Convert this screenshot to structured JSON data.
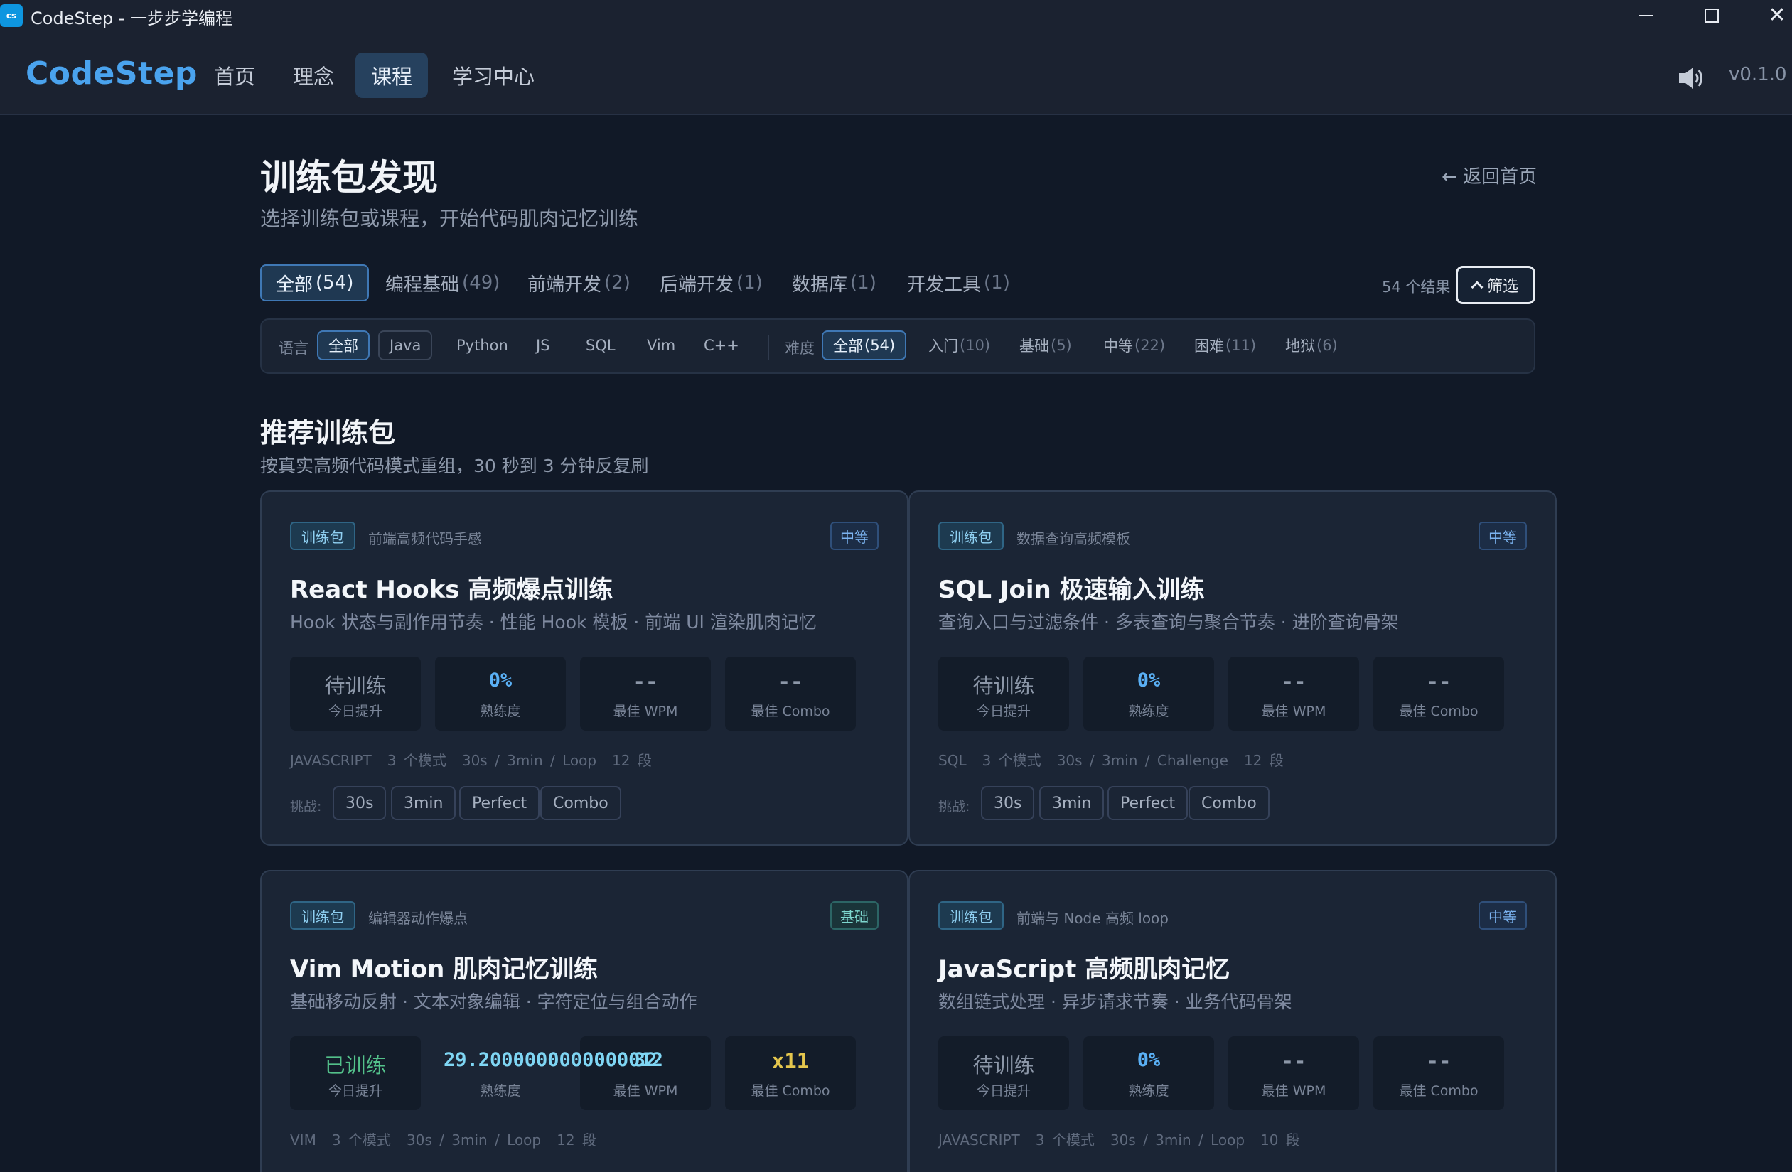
{
  "window": {
    "icon_text": "cs",
    "title": "CodeStep - 一步步学编程",
    "controls": {
      "minimize": "minimize",
      "maximize": "maximize",
      "close": "✕"
    }
  },
  "nav": {
    "brand": "CodeStep",
    "items": [
      "首页",
      "理念",
      "课程",
      "学习中心"
    ],
    "active_index": 2,
    "version": "v0.1.0"
  },
  "header": {
    "title": "训练包发现",
    "subtitle": "选择训练包或课程，开始代码肌肉记忆训练",
    "back_link": "← 返回首页"
  },
  "categories": [
    {
      "label": "全部",
      "count": "(54)",
      "active": true
    },
    {
      "label": "编程基础",
      "count": "(49)"
    },
    {
      "label": "前端开发",
      "count": "(2)"
    },
    {
      "label": "后端开发",
      "count": "(1)"
    },
    {
      "label": "数据库",
      "count": "(1)"
    },
    {
      "label": "开发工具",
      "count": "(1)"
    }
  ],
  "result_count": "54 个结果",
  "filter_button": "筛选",
  "filters": {
    "language_label": "语言",
    "languages": [
      "全部",
      "Java",
      "Python",
      "JS",
      "SQL",
      "Vim",
      "C++"
    ],
    "difficulty_label": "难度",
    "difficulties": [
      {
        "label": "全部",
        "count": "(54)"
      },
      {
        "label": "入门",
        "count": "(10)"
      },
      {
        "label": "基础",
        "count": "(5)"
      },
      {
        "label": "中等",
        "count": "(22)"
      },
      {
        "label": "困难",
        "count": "(11)"
      },
      {
        "label": "地狱",
        "count": "(6)"
      }
    ]
  },
  "section": {
    "title": "推荐训练包",
    "subtitle": "按真实高频代码模式重组，30 秒到 3 分钟反复刷"
  },
  "cards": [
    {
      "tag": "训练包",
      "desc": "前端高频代码手感",
      "level": "中等",
      "title": "React Hooks 高频爆点训练",
      "subtitle": "Hook 状态与副作用节奏 · 性能 Hook 模板 · 前端 UI 渲染肌肉记忆",
      "stats": [
        {
          "value": "待训练",
          "label": "今日提升"
        },
        {
          "value": "0%",
          "label": "熟练度"
        },
        {
          "value": "--",
          "label": "最佳 WPM"
        },
        {
          "value": "--",
          "label": "最佳 Combo"
        }
      ],
      "meta": [
        "JAVASCRIPT",
        "3 个模式",
        "30s / 3min / Loop",
        "12 段"
      ],
      "challenge_label": "挑战:",
      "challenges": [
        "30s",
        "3min",
        "Perfect",
        "Combo"
      ]
    },
    {
      "tag": "训练包",
      "desc": "数据查询高频模板",
      "level": "中等",
      "title": "SQL Join 极速输入训练",
      "subtitle": "查询入口与过滤条件 · 多表查询与聚合节奏 · 进阶查询骨架",
      "stats": [
        {
          "value": "待训练",
          "label": "今日提升"
        },
        {
          "value": "0%",
          "label": "熟练度"
        },
        {
          "value": "--",
          "label": "最佳 WPM"
        },
        {
          "value": "--",
          "label": "最佳 Combo"
        }
      ],
      "meta": [
        "SQL",
        "3 个模式",
        "30s / 3min / Challenge",
        "12 段"
      ],
      "challenge_label": "挑战:",
      "challenges": [
        "30s",
        "3min",
        "Perfect",
        "Combo"
      ]
    },
    {
      "tag": "训练包",
      "desc": "编辑器动作爆点",
      "level": "基础",
      "title": "Vim Motion 肌肉记忆训练",
      "subtitle": "基础移动反射 · 文本对象编辑 · 字符定位与组合动作",
      "stats": [
        {
          "value": "已训练",
          "label": "今日提升"
        },
        {
          "value": "29.2000000000000012",
          "label": "熟练度"
        },
        {
          "value": "32",
          "label": "最佳 WPM"
        },
        {
          "value": "x11",
          "label": "最佳 Combo"
        }
      ],
      "meta": [
        "VIM",
        "3 个模式",
        "30s / 3min / Loop",
        "12 段"
      ]
    },
    {
      "tag": "训练包",
      "desc": "前端与 Node 高频 loop",
      "level": "中等",
      "title": "JavaScript 高频肌肉记忆",
      "subtitle": "数组链式处理 · 异步请求节奏 · 业务代码骨架",
      "stats": [
        {
          "value": "待训练",
          "label": "今日提升"
        },
        {
          "value": "0%",
          "label": "熟练度"
        },
        {
          "value": "--",
          "label": "最佳 WPM"
        },
        {
          "value": "--",
          "label": "最佳 Combo"
        }
      ],
      "meta": [
        "JAVASCRIPT",
        "3 个模式",
        "30s / 3min / Loop",
        "10 段"
      ]
    }
  ]
}
